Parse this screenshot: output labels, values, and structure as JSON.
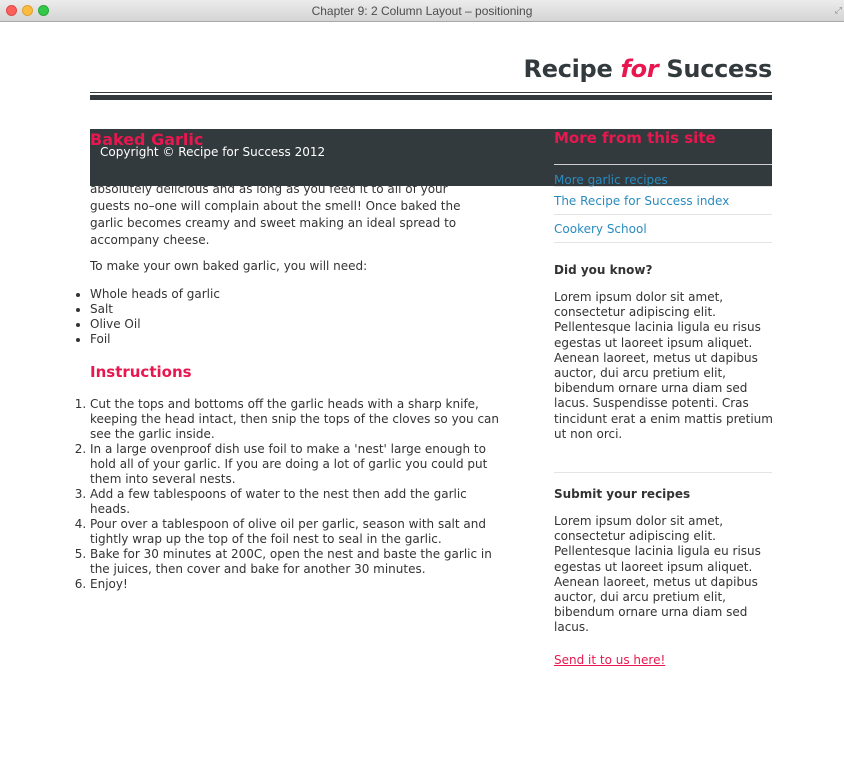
{
  "window": {
    "title": "Chapter 9: 2 Column Layout – positioning"
  },
  "site": {
    "name_part1": "Recipe",
    "name_for": "for",
    "name_part2": "Success"
  },
  "main": {
    "recipe_title": "Baked Garlic",
    "paragraph1": "absolutely delicious and as long as you feed it to all of your guests no–one will complain about the smell! Once baked the garlic becomes creamy and sweet making an ideal spread to accompany cheese.",
    "paragraph2": "To make your own baked garlic, you will need:",
    "ingredients": [
      "Whole heads of garlic",
      "Salt",
      "Olive Oil",
      "Foil"
    ],
    "instructions_title": "Instructions",
    "steps": [
      "Cut the tops and bottoms off the garlic heads with a sharp knife, keeping the head intact, then snip the tops of the cloves so you can see the garlic inside.",
      "In a large ovenproof dish use foil to make a 'nest' large enough to hold all of your garlic. If you are doing a lot of garlic you could put them into several nests.",
      "Add a few tablespoons of water to the nest then add the garlic heads.",
      "Pour over a tablespoon of olive oil per garlic, season with salt and tightly wrap up the top of the foil nest to seal in the garlic.",
      "Bake for 30 minutes at 200C, open the nest and baste the garlic in the juices, then cover and bake for another 30 minutes.",
      "Enjoy!"
    ]
  },
  "footer": {
    "copyright": "Copyright © Recipe for Success 2012"
  },
  "sidebar": {
    "heading": "More from this site",
    "links": [
      "More garlic recipes",
      "The Recipe for Success index",
      "Cookery School"
    ],
    "did_you_know_title": "Did you know?",
    "did_you_know_text": "Lorem ipsum dolor sit amet, consectetur adipiscing elit. Pellentesque lacinia ligula eu risus egestas ut laoreet ipsum aliquet. Aenean laoreet, metus ut dapibus auctor, dui arcu pretium elit, bibendum ornare urna diam sed lacus. Suspendisse potenti. Cras tincidunt erat a enim mattis pretium ut non orci.",
    "submit_title": "Submit your recipes",
    "submit_text": "Lorem ipsum dolor sit amet, consectetur adipiscing elit. Pellentesque lacinia ligula eu risus egestas ut laoreet ipsum aliquet. Aenean laoreet, metus ut dapibus auctor, dui arcu pretium elit, bibendum ornare urna diam sed lacus.",
    "send_link": "Send it to us here!"
  },
  "colors": {
    "accent": "#e8174f",
    "dark": "#333a3d",
    "link": "#2a8bbf"
  }
}
